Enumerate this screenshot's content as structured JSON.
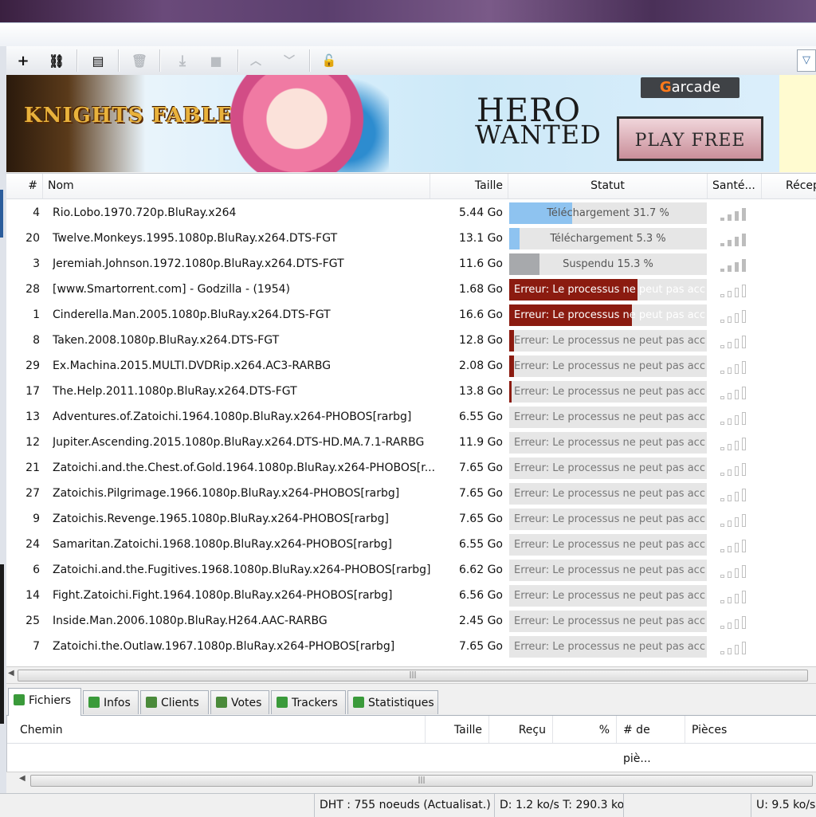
{
  "toolbar": {
    "icons": [
      "add-icon",
      "link-icon",
      "new-file-icon",
      "trash-icon",
      "download-icon",
      "stop-icon",
      "move-up-icon",
      "move-down-icon",
      "lock-icon",
      "filter-icon"
    ]
  },
  "banner": {
    "logo": "KNIGHTS FABLE",
    "headline1": "HERO",
    "headline2": "WANTED",
    "brand_prefix": "G",
    "brand_suffix": "arcade",
    "cta": "PLAY FREE"
  },
  "columns": {
    "num": "#",
    "name": "Nom",
    "size": "Taille",
    "status": "Statut",
    "health": "Santé...",
    "received": "Récep"
  },
  "colors": {
    "download": "#8ec3f0",
    "paused": "#a7a9ac",
    "error": "#8b1b10"
  },
  "torrents": [
    {
      "num": "4",
      "name": "Rio.Lobo.1970.720p.BluRay.x264",
      "size": "5.44 Go",
      "status": "Téléchargement 31.7 %",
      "kind": "download",
      "progress": 31.7,
      "health": 4
    },
    {
      "num": "20",
      "name": "Twelve.Monkeys.1995.1080p.BluRay.x264.DTS-FGT",
      "size": "13.1 Go",
      "status": "Téléchargement 5.3 %",
      "kind": "download",
      "progress": 5.3,
      "health": 4
    },
    {
      "num": "3",
      "name": "Jeremiah.Johnson.1972.1080p.BluRay.x264.DTS-FGT",
      "size": "11.6 Go",
      "status": "Suspendu 15.3 %",
      "kind": "paused",
      "progress": 15.3,
      "health": 4
    },
    {
      "num": "28",
      "name": "[www.Smartorrent.com] - Godzilla - (1954)",
      "size": "1.68 Go",
      "status": "Erreur: Le processus ne peut pas acc",
      "kind": "error",
      "progress": 65,
      "health": 0
    },
    {
      "num": "1",
      "name": "Cinderella.Man.2005.1080p.BluRay.x264.DTS-FGT",
      "size": "16.6 Go",
      "status": "Erreur: Le processus ne peut pas acc",
      "kind": "error",
      "progress": 62,
      "health": 0
    },
    {
      "num": "8",
      "name": "Taken.2008.1080p.BluRay.x264.DTS-FGT",
      "size": "12.8 Go",
      "status": "Erreur: Le processus ne peut pas acc",
      "kind": "error",
      "progress": 2.4,
      "health": 0
    },
    {
      "num": "29",
      "name": "Ex.Machina.2015.MULTI.DVDRip.x264.AC3-RARBG",
      "size": "2.08 Go",
      "status": "Erreur: Le processus ne peut pas acc",
      "kind": "error",
      "progress": 2.4,
      "health": 0
    },
    {
      "num": "17",
      "name": "The.Help.2011.1080p.BluRay.x264.DTS-FGT",
      "size": "13.8 Go",
      "status": "Erreur: Le processus ne peut pas acc",
      "kind": "error",
      "progress": 1.2,
      "health": 0
    },
    {
      "num": "13",
      "name": "Adventures.of.Zatoichi.1964.1080p.BluRay.x264-PHOBOS[rarbg]",
      "size": "6.55 Go",
      "status": "Erreur: Le processus ne peut pas acc",
      "kind": "error",
      "progress": 0,
      "health": 0
    },
    {
      "num": "12",
      "name": "Jupiter.Ascending.2015.1080p.BluRay.x264.DTS-HD.MA.7.1-RARBG",
      "size": "11.9 Go",
      "status": "Erreur: Le processus ne peut pas acc",
      "kind": "error",
      "progress": 0,
      "health": 0
    },
    {
      "num": "21",
      "name": "Zatoichi.and.the.Chest.of.Gold.1964.1080p.BluRay.x264-PHOBOS[r...",
      "size": "7.65 Go",
      "status": "Erreur: Le processus ne peut pas acc",
      "kind": "error",
      "progress": 0,
      "health": 0
    },
    {
      "num": "27",
      "name": "Zatoichis.Pilgrimage.1966.1080p.BluRay.x264-PHOBOS[rarbg]",
      "size": "7.65 Go",
      "status": "Erreur: Le processus ne peut pas acc",
      "kind": "error",
      "progress": 0,
      "health": 0
    },
    {
      "num": "9",
      "name": "Zatoichis.Revenge.1965.1080p.BluRay.x264-PHOBOS[rarbg]",
      "size": "7.65 Go",
      "status": "Erreur: Le processus ne peut pas acc",
      "kind": "error",
      "progress": 0,
      "health": 0
    },
    {
      "num": "24",
      "name": "Samaritan.Zatoichi.1968.1080p.BluRay.x264-PHOBOS[rarbg]",
      "size": "6.55 Go",
      "status": "Erreur: Le processus ne peut pas acc",
      "kind": "error",
      "progress": 0,
      "health": 0
    },
    {
      "num": "6",
      "name": "Zatoichi.and.the.Fugitives.1968.1080p.BluRay.x264-PHOBOS[rarbg]",
      "size": "6.62 Go",
      "status": "Erreur: Le processus ne peut pas acc",
      "kind": "error",
      "progress": 0,
      "health": 0
    },
    {
      "num": "14",
      "name": "Fight.Zatoichi.Fight.1964.1080p.BluRay.x264-PHOBOS[rarbg]",
      "size": "6.56 Go",
      "status": "Erreur: Le processus ne peut pas acc",
      "kind": "error",
      "progress": 0,
      "health": 0
    },
    {
      "num": "25",
      "name": "Inside.Man.2006.1080p.BluRay.H264.AAC-RARBG",
      "size": "2.45 Go",
      "status": "Erreur: Le processus ne peut pas acc",
      "kind": "error",
      "progress": 0,
      "health": 0
    },
    {
      "num": "7",
      "name": "Zatoichi.the.Outlaw.1967.1080p.BluRay.x264-PHOBOS[rarbg]",
      "size": "7.65 Go",
      "status": "Erreur: Le processus ne peut pas acc",
      "kind": "error",
      "progress": 0,
      "health": 0
    }
  ],
  "tabs": [
    {
      "label": "Fichiers",
      "icon": "files-icon",
      "active": true
    },
    {
      "label": "Infos",
      "icon": "info-icon",
      "active": false
    },
    {
      "label": "Clients",
      "icon": "peers-icon",
      "active": false
    },
    {
      "label": "Votes",
      "icon": "ratings-icon",
      "active": false
    },
    {
      "label": "Trackers",
      "icon": "trackers-icon",
      "active": false
    },
    {
      "label": "Statistiques",
      "icon": "graph-icon",
      "active": false
    }
  ],
  "files_columns": {
    "path": "Chemin",
    "size": "Taille",
    "received": "Reçu",
    "percent": "%",
    "pieces_count": "# de piè...",
    "pieces": "Pièces"
  },
  "statusbar": {
    "dht": "DHT : 755 noeuds (Actualisat.)",
    "download": "D: 1.2 ko/s T: 290.3 ko",
    "upload": "U: 9.5 ko/s"
  }
}
